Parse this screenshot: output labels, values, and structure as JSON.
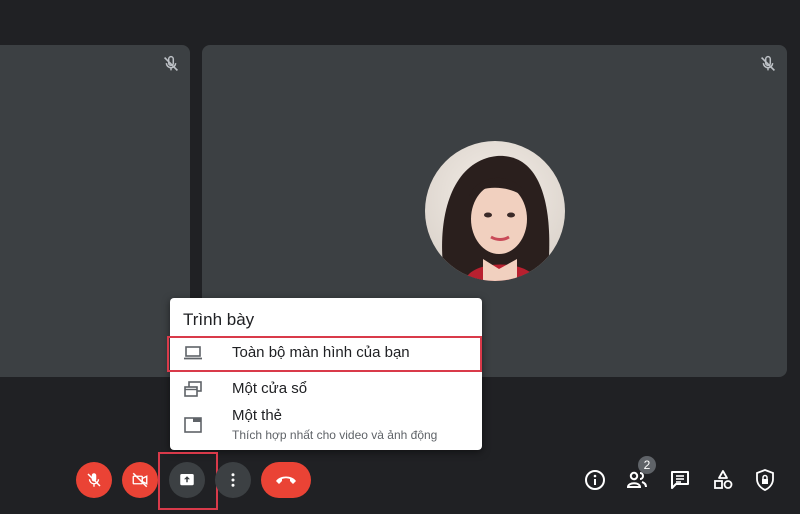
{
  "present_menu": {
    "title": "Trình bày",
    "items": [
      {
        "label": "Toàn bộ màn hình của bạn",
        "icon": "laptop-icon"
      },
      {
        "label": "Một cửa sổ",
        "icon": "window-icon"
      },
      {
        "label": "Một thẻ",
        "sublabel": "Thích hợp nhất cho video và ảnh động",
        "icon": "tab-icon"
      }
    ]
  },
  "participants_count": "2",
  "bottom_controls": [
    "mic-off-icon",
    "camera-off-icon",
    "present-screen-icon",
    "more-vert-icon",
    "hang-up-icon"
  ],
  "right_controls": [
    "info-icon",
    "people-icon",
    "chat-icon",
    "activities-icon",
    "host-controls-lock-icon"
  ],
  "colors": {
    "background": "#202124",
    "tile": "#3c4043",
    "danger": "#ea4335",
    "highlight": "#d93a4a"
  }
}
